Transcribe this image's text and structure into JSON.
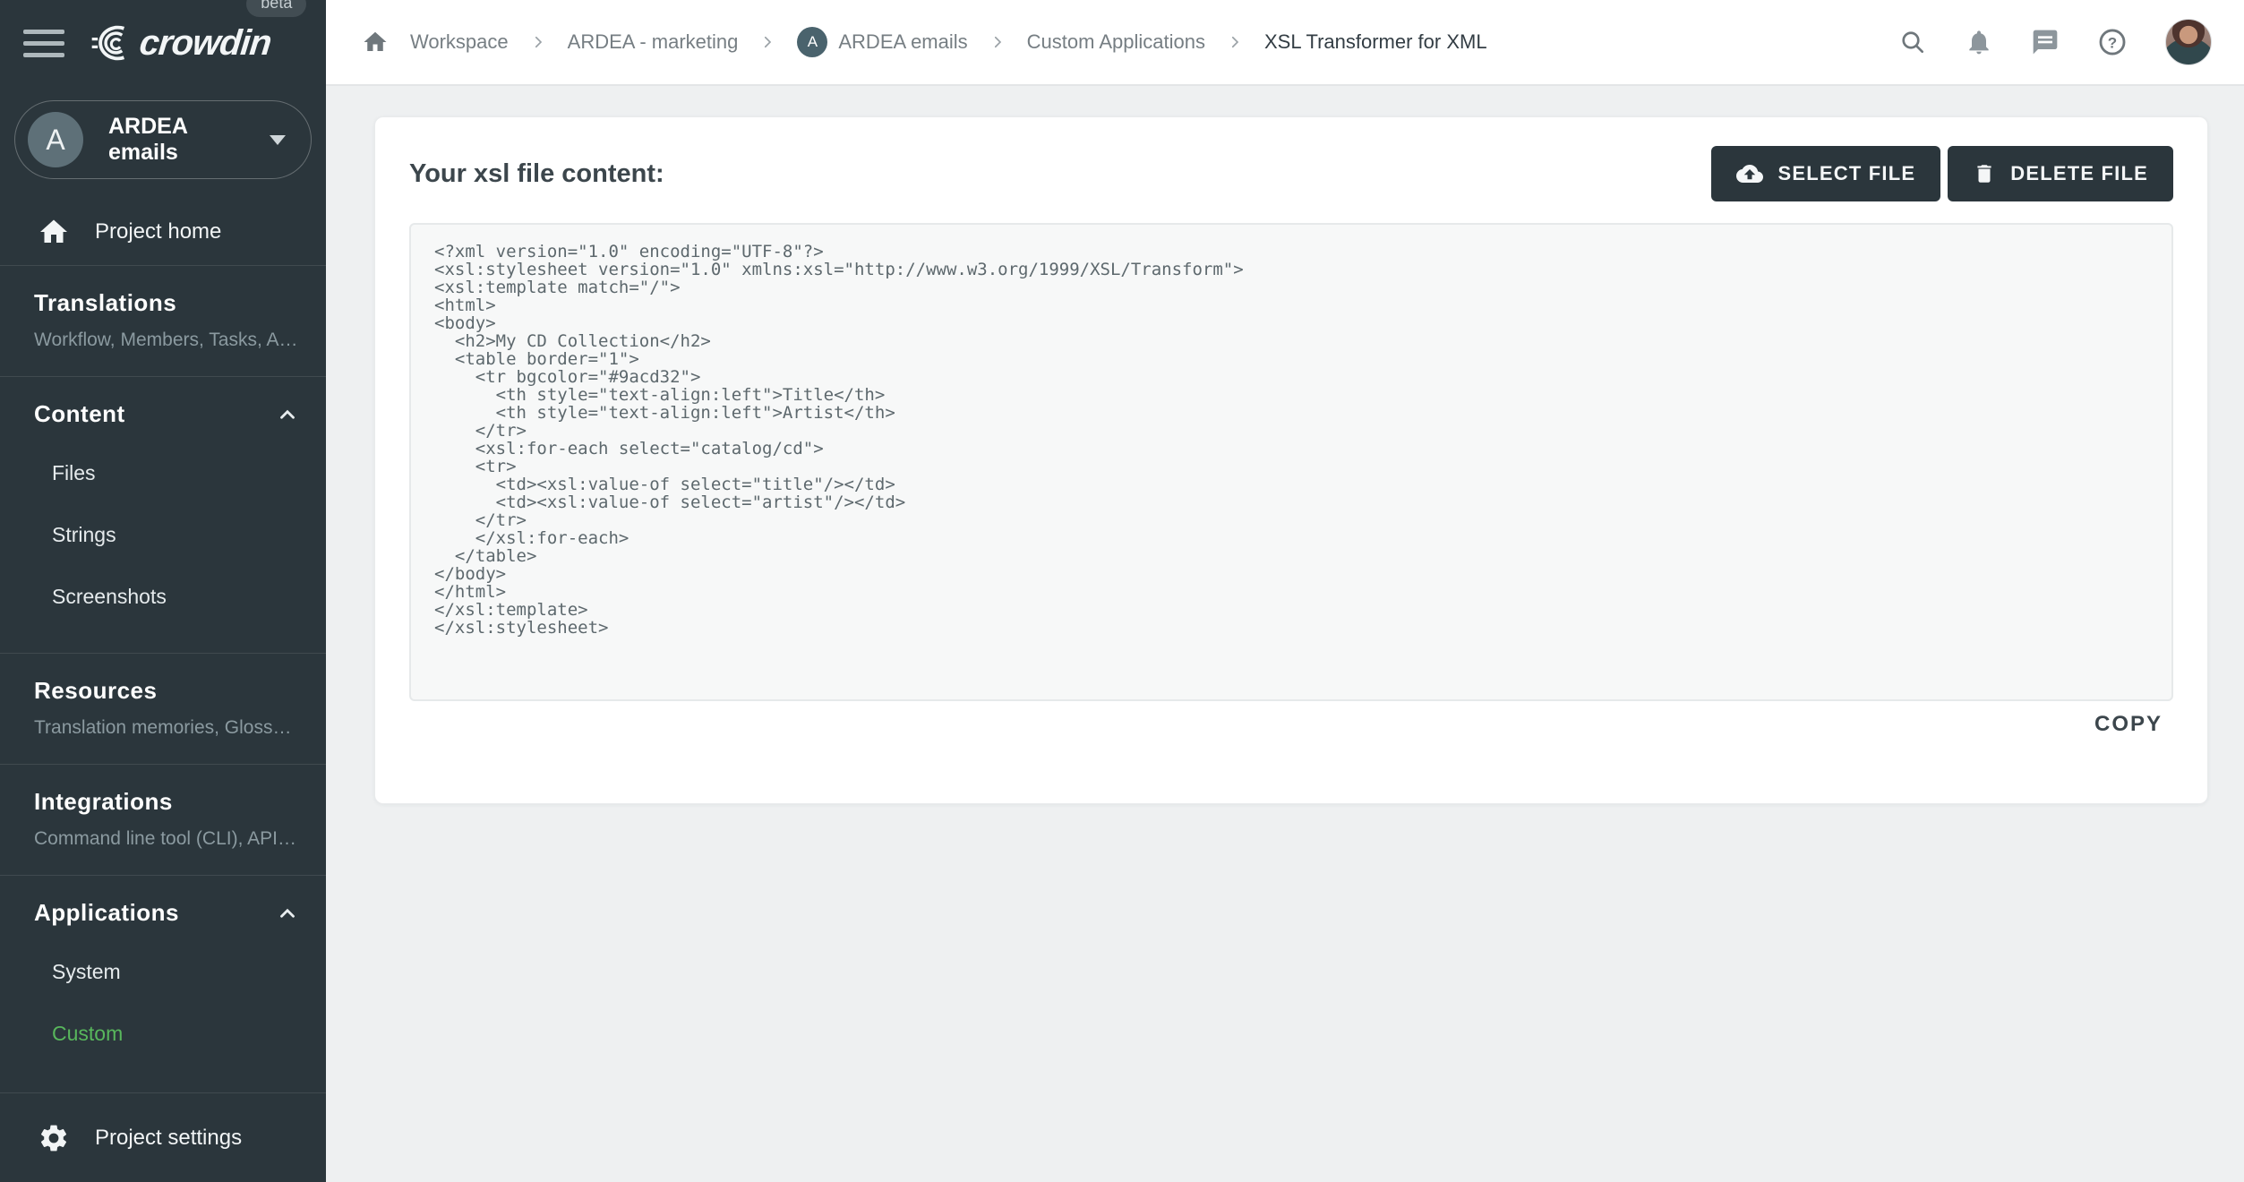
{
  "brand": {
    "name": "crowdin",
    "beta_label": "beta"
  },
  "sidebar": {
    "project_selector": {
      "initial": "A",
      "name": "ARDEA emails"
    },
    "project_home_label": "Project home",
    "sections": [
      {
        "title": "Translations",
        "subtitle": "Workflow, Members, Tasks, Act…"
      },
      {
        "title": "Content",
        "expanded": true,
        "items": [
          "Files",
          "Strings",
          "Screenshots"
        ]
      },
      {
        "title": "Resources",
        "subtitle": "Translation memories, Glossari…"
      },
      {
        "title": "Integrations",
        "subtitle": "Command line tool (CLI), API, A…"
      },
      {
        "title": "Applications",
        "expanded": true,
        "items": [
          "System",
          "Custom"
        ],
        "active_item": "Custom"
      }
    ],
    "project_settings_label": "Project settings"
  },
  "topbar": {
    "breadcrumbs": [
      "Workspace",
      "ARDEA - marketing",
      "ARDEA emails",
      "Custom Applications",
      "XSL Transformer for XML"
    ],
    "breadcrumb_avatar_initial": "A"
  },
  "main": {
    "heading": "Your xsl file content:",
    "select_file_label": "SELECT FILE",
    "delete_file_label": "DELETE FILE",
    "copy_label": "COPY",
    "code": "<?xml version=\"1.0\" encoding=\"UTF-8\"?>\n<xsl:stylesheet version=\"1.0\" xmlns:xsl=\"http://www.w3.org/1999/XSL/Transform\">\n<xsl:template match=\"/\">\n<html>\n<body>\n  <h2>My CD Collection</h2>\n  <table border=\"1\">\n    <tr bgcolor=\"#9acd32\">\n      <th style=\"text-align:left\">Title</th>\n      <th style=\"text-align:left\">Artist</th>\n    </tr>\n    <xsl:for-each select=\"catalog/cd\">\n    <tr>\n      <td><xsl:value-of select=\"title\"/></td>\n      <td><xsl:value-of select=\"artist\"/></td>\n    </tr>\n    </xsl:for-each>\n  </table>\n</body>\n</html>\n</xsl:template>\n</xsl:stylesheet>"
  },
  "icons": {
    "sidebar": [
      "hamburger-icon",
      "crowdin-logo",
      "home-icon",
      "chevron-up-icon",
      "gear-icon",
      "caret-down-icon"
    ],
    "topbar": [
      "home-icon",
      "chevron-right-icon",
      "search-icon",
      "bell-icon",
      "chat-icon",
      "help-icon",
      "user-avatar"
    ],
    "buttons": [
      "cloud-upload-icon",
      "trash-icon"
    ]
  },
  "colors": {
    "sidebar_bg": "#2b363c",
    "active_green": "#58b75c",
    "page_bg": "#eef0f1",
    "button_bg": "#2b363c",
    "code_bg": "#f7f8f8"
  }
}
